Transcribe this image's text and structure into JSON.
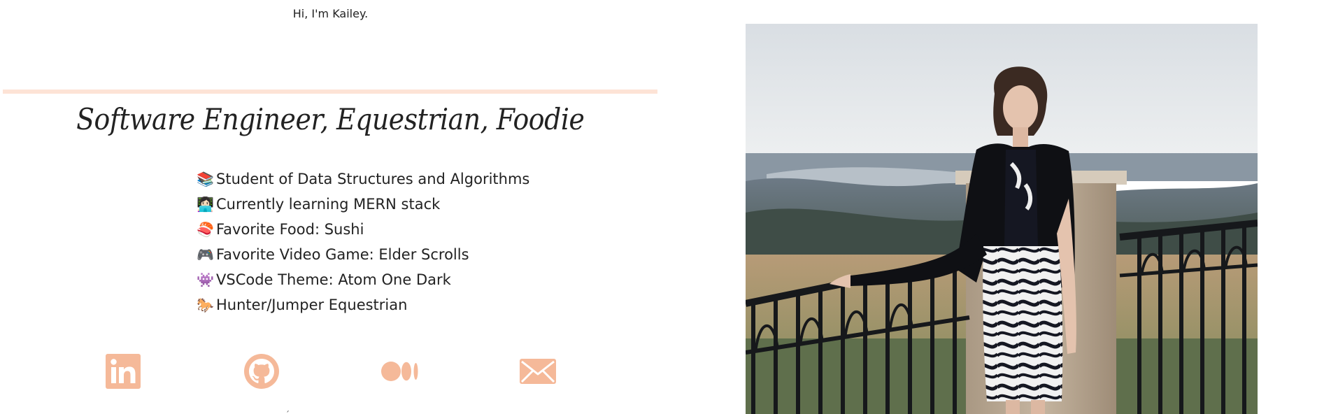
{
  "hero": {
    "hi": "Hi",
    "rest": ", I'm Kailey.",
    "tagline": "Software Engineer, Equestrian, Foodie"
  },
  "facts": [
    {
      "emoji": "📚",
      "text": "Student of Data Structures and Algorithms"
    },
    {
      "emoji": "👩🏻‍💻",
      "text": "Currently learning MERN stack"
    },
    {
      "emoji": "🍣",
      "text": "Favorite Food: Sushi"
    },
    {
      "emoji": "🎮",
      "text": "Favorite Video Game: Elder Scrolls"
    },
    {
      "emoji": "👾",
      "text": "VSCode Theme: Atom One Dark"
    },
    {
      "emoji": "🐎",
      "text": "Hunter/Jumper Equestrian"
    }
  ],
  "socials": [
    {
      "icon": "linkedin-icon"
    },
    {
      "icon": "github-icon"
    },
    {
      "icon": "medium-icon"
    },
    {
      "icon": "email-icon"
    }
  ],
  "colors": {
    "accent": "#f5b999",
    "divider": "#fde3d6",
    "text": "#222222"
  },
  "photo": {
    "icon": "portrait-photo"
  }
}
